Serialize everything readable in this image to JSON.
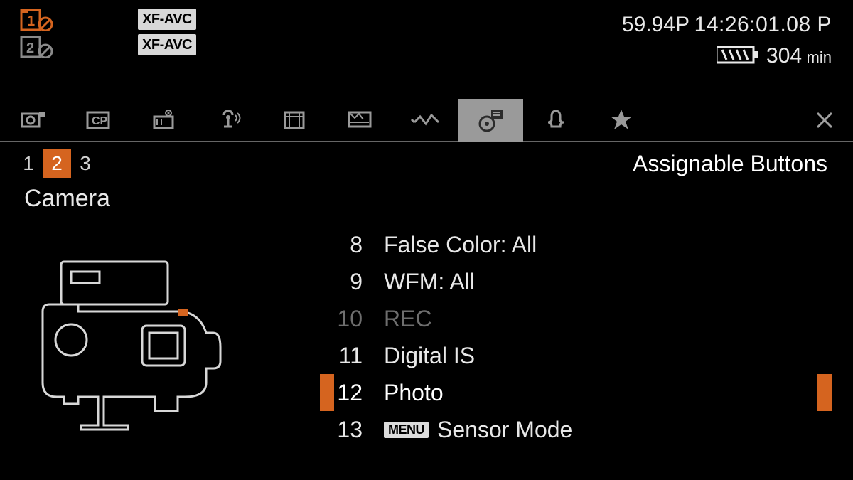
{
  "top": {
    "codec1": "XF-AVC",
    "codec2": "XF-AVC",
    "fps": "59.94P",
    "clock": "14:26:01.08 P",
    "battery_time": "304",
    "battery_unit": "min"
  },
  "pages": {
    "p1": "1",
    "p2": "2",
    "p3": "3"
  },
  "section": {
    "title": "Assignable Buttons",
    "sub": "Camera"
  },
  "rows": [
    {
      "num": "8",
      "label": "False Color: All",
      "dim": false,
      "selected": false,
      "badge": ""
    },
    {
      "num": "9",
      "label": "WFM: All",
      "dim": false,
      "selected": false,
      "badge": ""
    },
    {
      "num": "10",
      "label": "REC",
      "dim": true,
      "selected": false,
      "badge": ""
    },
    {
      "num": "11",
      "label": "Digital IS",
      "dim": false,
      "selected": false,
      "badge": ""
    },
    {
      "num": "12",
      "label": "Photo",
      "dim": false,
      "selected": true,
      "badge": ""
    },
    {
      "num": "13",
      "label": "Sensor Mode",
      "dim": false,
      "selected": false,
      "badge": "MENU"
    }
  ]
}
